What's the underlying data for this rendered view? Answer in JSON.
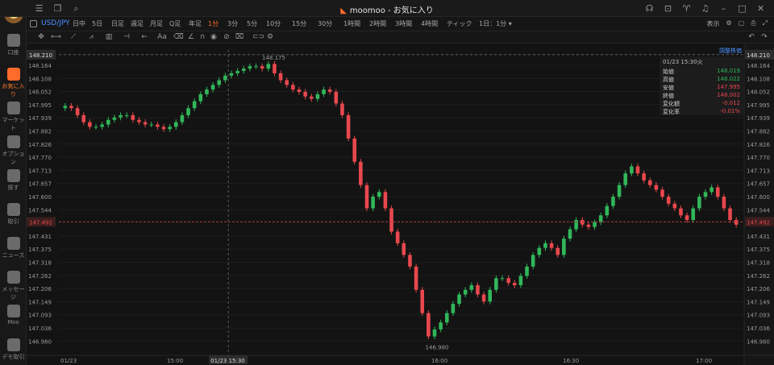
{
  "app": {
    "title": "moomoo - お気に入り"
  },
  "sidebar": {
    "items": [
      {
        "label": "口座",
        "icon": "person-icon"
      },
      {
        "label": "お気に入り",
        "icon": "chart-bars-icon",
        "active": true
      },
      {
        "label": "マーケット",
        "icon": "trend-icon"
      },
      {
        "label": "オプション",
        "icon": "options-icon"
      },
      {
        "label": "探す",
        "icon": "filter-icon"
      },
      {
        "label": "取引",
        "icon": "trade-icon"
      },
      {
        "label": "ニュース",
        "icon": "news-icon"
      },
      {
        "label": "メッセージ",
        "icon": "message-icon"
      },
      {
        "label": "Moo",
        "icon": "moo-icon"
      },
      {
        "label": "デモ取引",
        "icon": "demo-icon"
      }
    ]
  },
  "toolbar": {
    "symbol": "USD/JPY",
    "timeframes": [
      "日中",
      "5日",
      "日足",
      "週足",
      "月足",
      "Q足",
      "年足",
      "1分",
      "3分",
      "5分",
      "10分",
      "15分",
      "30分",
      "1時間",
      "2時間",
      "3時間",
      "4時間",
      "ティック",
      "1日：1分 ▾"
    ],
    "active_timeframe": "1分",
    "display_label": "表示"
  },
  "chart_overlay": {
    "adjust_label": "調整株価"
  },
  "info_box": {
    "header": "01/23 15:30火",
    "rows": [
      {
        "label": "始値",
        "value": "148.019",
        "dir": "up"
      },
      {
        "label": "高値",
        "value": "148.022",
        "dir": "up"
      },
      {
        "label": "安値",
        "value": "147.995",
        "dir": "dn"
      },
      {
        "label": "終値",
        "value": "148.002",
        "dir": "dn"
      },
      {
        "label": "変化額",
        "value": "-0.012",
        "dir": "dn"
      },
      {
        "label": "変化率",
        "value": "-0.01%",
        "dir": "dn"
      }
    ]
  },
  "colors": {
    "up": "#31b75a",
    "down": "#e8484e",
    "accent": "#ff6b2b",
    "link": "#4a90ff"
  },
  "chart_data": {
    "type": "candlestick",
    "title": "",
    "symbol": "USD/JPY",
    "interval": "1分",
    "y_ticks": [
      "148.210",
      "148.164",
      "148.108",
      "148.052",
      "147.995",
      "147.939",
      "147.882",
      "147.826",
      "147.770",
      "147.713",
      "147.657",
      "147.600",
      "147.544",
      "147.431",
      "147.375",
      "147.318",
      "147.262",
      "147.206",
      "147.149",
      "147.093",
      "147.036",
      "146.980"
    ],
    "ylim": [
      146.95,
      148.23
    ],
    "x_ticks": [
      "01/23",
      "15:00",
      "15:30",
      "16:00",
      "16:30",
      "17:00"
    ],
    "current_price": "147.492",
    "crosshair": {
      "price": "148.210",
      "time": "01/23 15:30"
    },
    "annotations": {
      "high": "148.175",
      "low": "146.980"
    },
    "series": [
      {
        "name": "USD/JPY",
        "close": [
          147.99,
          147.98,
          147.95,
          147.92,
          147.9,
          147.9,
          147.91,
          147.93,
          147.94,
          147.95,
          147.95,
          147.93,
          147.92,
          147.91,
          147.91,
          147.9,
          147.89,
          147.9,
          147.92,
          147.95,
          147.98,
          148.01,
          148.04,
          148.06,
          148.08,
          148.1,
          148.12,
          148.13,
          148.14,
          148.15,
          148.16,
          148.16,
          148.15,
          148.17,
          148.13,
          148.1,
          148.08,
          148.06,
          148.05,
          148.03,
          148.02,
          148.04,
          148.06,
          148.05,
          148.0,
          147.95,
          147.85,
          147.75,
          147.65,
          147.55,
          147.6,
          147.62,
          147.55,
          147.45,
          147.4,
          147.35,
          147.3,
          147.2,
          147.1,
          147.0,
          147.03,
          147.06,
          147.1,
          147.14,
          147.18,
          147.2,
          147.22,
          147.18,
          147.15,
          147.2,
          147.25,
          147.25,
          147.23,
          147.22,
          147.26,
          147.3,
          147.35,
          147.38,
          147.4,
          147.38,
          147.35,
          147.42,
          147.46,
          147.5,
          147.48,
          147.47,
          147.49,
          147.52,
          147.56,
          147.6,
          147.65,
          147.7,
          147.73,
          147.7,
          147.67,
          147.65,
          147.63,
          147.6,
          147.57,
          147.55,
          147.52,
          147.5,
          147.55,
          147.6,
          147.62,
          147.64,
          147.6,
          147.55,
          147.5,
          147.48
        ]
      }
    ]
  }
}
